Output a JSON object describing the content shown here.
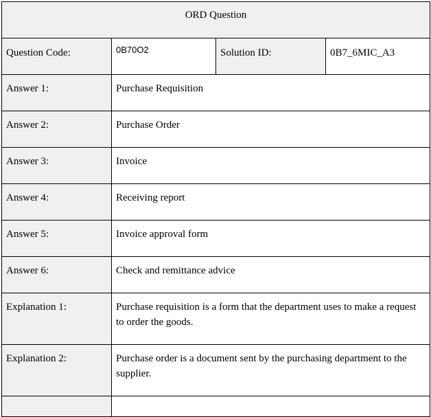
{
  "title": "ORD Question",
  "header": {
    "question_code_label": "Question Code:",
    "question_code_value": "0B70O2",
    "solution_id_label": "Solution ID:",
    "solution_id_value": "0B7_6MIC_A3"
  },
  "answers": [
    {
      "label": "Answer 1:",
      "value": "Purchase Requisition"
    },
    {
      "label": "Answer 2:",
      "value": "Purchase Order"
    },
    {
      "label": "Answer 3:",
      "value": "Invoice"
    },
    {
      "label": "Answer 4:",
      "value": "Receiving report"
    },
    {
      "label": "Answer 5:",
      "value": "Invoice approval form"
    },
    {
      "label": "Answer 6:",
      "value": "Check and remittance advice"
    }
  ],
  "explanations": [
    {
      "label": "Explanation 1:",
      "value": "Purchase requisition is a form that the department uses to make a request to order the goods."
    },
    {
      "label": "Explanation 2:",
      "value": "Purchase order is a document sent by the purchasing department to the supplier."
    }
  ]
}
